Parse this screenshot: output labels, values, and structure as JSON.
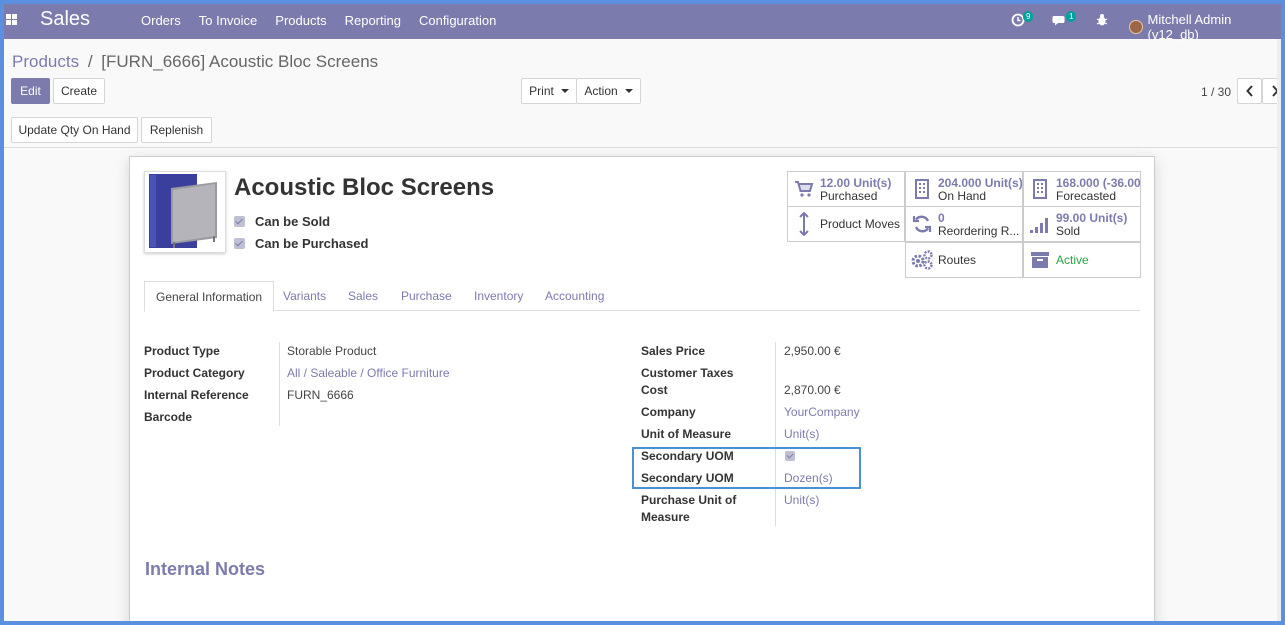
{
  "navbar": {
    "brand": "Sales",
    "menu": [
      "Orders",
      "To Invoice",
      "Products",
      "Reporting",
      "Configuration"
    ],
    "activity_count": "9",
    "messages_count": "1",
    "user": "Mitchell Admin (v12_db)"
  },
  "breadcrumb": {
    "parent": "Products",
    "separator": "/",
    "current": "[FURN_6666] Acoustic Bloc Screens"
  },
  "buttons": {
    "edit": "Edit",
    "create": "Create",
    "print": "Print",
    "action": "Action",
    "update_qty": "Update Qty On Hand",
    "replenish": "Replenish"
  },
  "pager": {
    "value": "1 / 30"
  },
  "product": {
    "name": "Acoustic Bloc Screens",
    "can_be_sold": "Can be Sold",
    "can_be_purchased": "Can be Purchased"
  },
  "smart_buttons": {
    "purchased_value": "12.00 Unit(s)",
    "purchased_label": "Purchased",
    "onhand_value": "204.000 Unit(s)",
    "onhand_label": "On Hand",
    "forecast_value": "168.000 (-36.00",
    "forecast_label": "Forecasted",
    "moves_label": "Product Moves",
    "reorder_value": "0",
    "reorder_label": "Reordering R...",
    "sold_value": "99.00 Unit(s)",
    "sold_label": "Sold",
    "routes_label": "Routes",
    "active_label": "Active"
  },
  "tabs": [
    "General Information",
    "Variants",
    "Sales",
    "Purchase",
    "Inventory",
    "Accounting"
  ],
  "left_fields": {
    "product_type_label": "Product Type",
    "product_type": "Storable Product",
    "category_label": "Product Category",
    "category": "All / Saleable / Office Furniture",
    "internal_ref_label": "Internal Reference",
    "internal_ref": "FURN_6666",
    "barcode_label": "Barcode"
  },
  "right_fields": {
    "sales_price_label": "Sales Price",
    "sales_price": "2,950.00 €",
    "customer_taxes_label": "Customer Taxes",
    "cost_label": "Cost",
    "cost": "2,870.00 €",
    "company_label": "Company",
    "company": "YourCompany",
    "uom_label": "Unit of Measure",
    "uom": "Unit(s)",
    "secondary_uom_flag_label": "Secondary UOM",
    "secondary_uom_label": "Secondary UOM",
    "secondary_uom": "Dozen(s)",
    "purchase_uom_label_1": "Purchase Unit of",
    "purchase_uom_label_2": "Measure",
    "purchase_uom": "Unit(s)"
  },
  "notes_title": "Internal Notes",
  "colors": {
    "brand": "#7c7bad",
    "active": "#28a745",
    "highlight": "#4a90d9"
  }
}
